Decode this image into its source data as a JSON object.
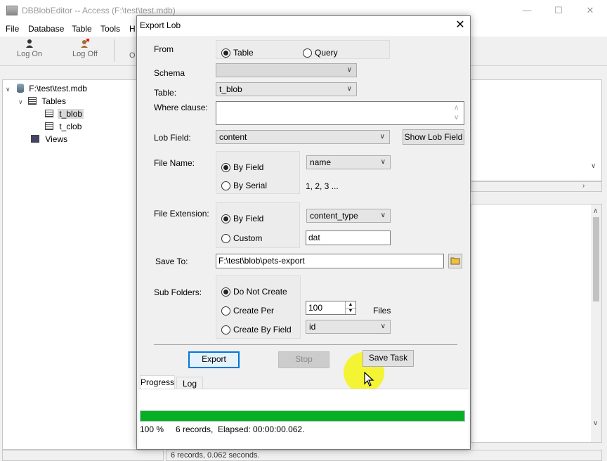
{
  "app": {
    "title": "DBBlobEditor -- Access (F:\\test\\test.mdb)",
    "minimize": "—",
    "maximize": "☐",
    "close": "✕"
  },
  "menu": {
    "file": "File",
    "database": "Database",
    "table": "Table",
    "tools": "Tools",
    "help": "H"
  },
  "toolbar": {
    "log_on": "Log On",
    "log_off": "Log Off",
    "o": "O"
  },
  "tree": {
    "root": "F:\\test\\test.mdb",
    "tables": "Tables",
    "t_blob": "t_blob",
    "t_clob": "t_clob",
    "views": "Views"
  },
  "status": {
    "right": "6 records, 0.062 seconds."
  },
  "dialog": {
    "title": "Export Lob",
    "close": "✕",
    "from_label": "From",
    "from_table": "Table",
    "from_query": "Query",
    "schema_label": "Schema",
    "schema_value": "",
    "table_label": "Table:",
    "table_value": "t_blob",
    "where_label": "Where clause:",
    "where_value": "",
    "lob_field_label": "Lob Field:",
    "lob_field_value": "content",
    "show_lob_field": "Show Lob Field",
    "file_name_label": "File Name:",
    "by_field": "By Field",
    "by_serial": "By Serial",
    "name_field_value": "name",
    "serial_example": "1, 2, 3 ...",
    "file_ext_label": "File Extension:",
    "ext_by_field": "By Field",
    "ext_custom": "Custom",
    "ext_field_value": "content_type",
    "ext_custom_value": "dat",
    "save_to_label": "Save To:",
    "save_to_value": "F:\\test\\blob\\pets-export",
    "sub_folders_label": "Sub Folders:",
    "do_not_create": "Do Not Create",
    "create_per": "Create Per",
    "create_by_field": "Create By Field",
    "per_count": "100",
    "files_label": "Files",
    "by_field_value": "id",
    "export": "Export",
    "stop": "Stop",
    "save_task": "Save Task",
    "tab_progress": "Progress",
    "tab_log": "Log",
    "progress_percent": "100 %",
    "progress_fraction": 1.0,
    "records": "6 records,",
    "elapsed": "Elapsed: 00:00:00.062."
  },
  "colors": {
    "progress": "#06b025",
    "highlight": "#f5f514",
    "default_button": "#0078d7"
  }
}
